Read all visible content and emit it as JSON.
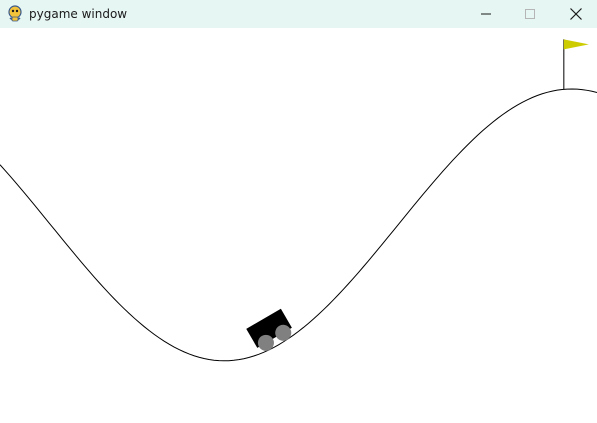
{
  "window": {
    "title": "pygame window",
    "app_icon": "pygame-snake-icon",
    "controls": [
      "minimize-icon",
      "maximize-icon",
      "close-icon"
    ]
  },
  "game": {
    "environment": "mountain-car",
    "colors": {
      "background": "#ffffff",
      "track": "#000000",
      "car_body": "#000000",
      "wheels": "#808080",
      "flag": "#cccc00",
      "flagpole": "#000000",
      "titlebar": "#e6f6f3"
    },
    "state": {
      "car_position": -0.36,
      "car_velocity": 0.0
    },
    "goal_position": 0.5
  }
}
